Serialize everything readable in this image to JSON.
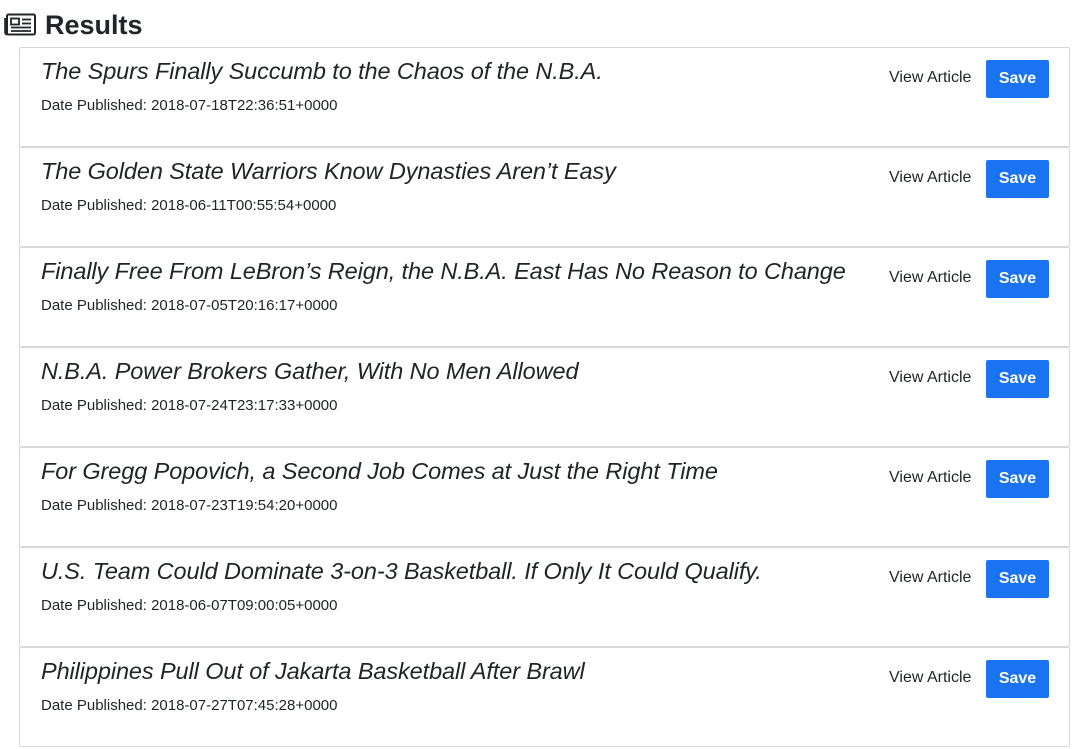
{
  "header": {
    "icon": "newspaper-icon",
    "title": "Results"
  },
  "actions": {
    "view_label": "View Article",
    "save_label": "Save"
  },
  "articles": [
    {
      "headline": "The Spurs Finally Succumb to the Chaos of the N.B.A.",
      "date": "Date Published: 2018-07-18T22:36:51+0000"
    },
    {
      "headline": "The Golden State Warriors Know Dynasties Aren’t Easy",
      "date": "Date Published: 2018-06-11T00:55:54+0000"
    },
    {
      "headline": "Finally Free From LeBron’s Reign, the N.B.A. East Has No Reason to Change",
      "date": "Date Published: 2018-07-05T20:16:17+0000"
    },
    {
      "headline": "N.B.A. Power Brokers Gather, With No Men Allowed",
      "date": "Date Published: 2018-07-24T23:17:33+0000"
    },
    {
      "headline": "For Gregg Popovich, a Second Job Comes at Just the Right Time",
      "date": "Date Published: 2018-07-23T19:54:20+0000"
    },
    {
      "headline": "U.S. Team Could Dominate 3-on-3 Basketball. If Only It Could Qualify.",
      "date": "Date Published: 2018-06-07T09:00:05+0000"
    },
    {
      "headline": "Philippines Pull Out of Jakarta Basketball After Brawl",
      "date": "Date Published: 2018-07-27T07:45:28+0000"
    }
  ],
  "colors": {
    "save_button": "#1a73f0",
    "text": "#212529",
    "card_border": "#d8d8d8"
  }
}
